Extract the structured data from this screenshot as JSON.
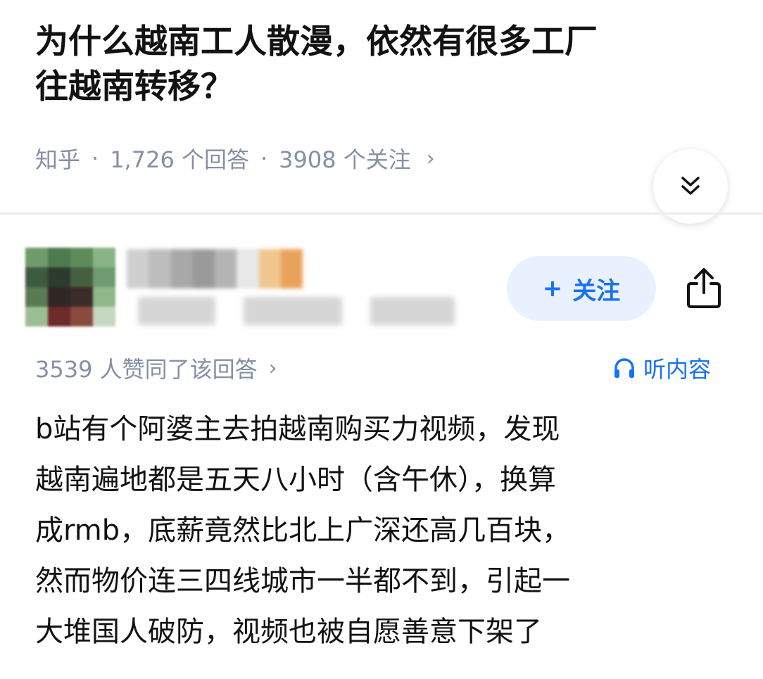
{
  "question": {
    "title_line1": "为什么越南工人散漫，依然有很多工厂",
    "title_line2": "往越南转移？",
    "source": "知乎",
    "separator": "·",
    "answers": "1,726 个回答",
    "followers": "3908 个关注",
    "chevron": "›"
  },
  "collapse_icon": "double-chevron-down-icon",
  "author": {
    "follow_plus": "+",
    "follow_label": "关注",
    "share_icon": "share-icon"
  },
  "answer": {
    "upvotes": "3539 人赞同了该回答",
    "chevron": "›",
    "listen_label": "听内容",
    "listen_icon": "headphones-icon",
    "lines": [
      "b站有个阿婆主去拍越南购买力视频，发现",
      "越南遍地都是五天八小时（含午休），换算",
      "成rmb，底薪竟然比北上广深还高几百块，",
      "然而物价连三四线城市一半都不到，引起一",
      "大堆国人破防，视频也被自愿善意下架了"
    ]
  },
  "colors": {
    "accent": "#1772f6",
    "follow_bg": "#e9f1fe",
    "meta_gray": "#8590a6",
    "text": "#121212"
  }
}
